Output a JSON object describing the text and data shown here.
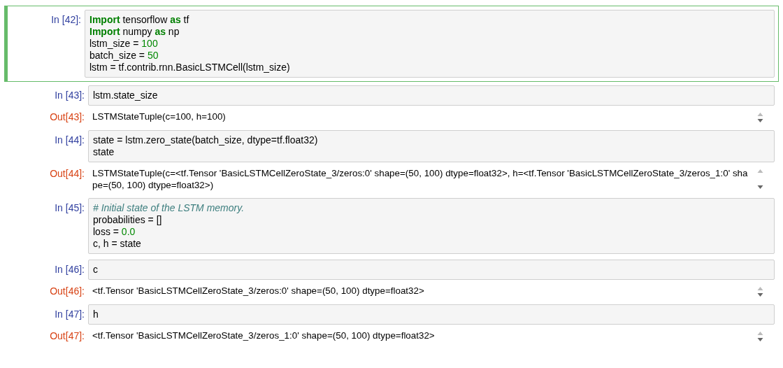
{
  "cells": [
    {
      "prompt": "In [42]:",
      "selected": true,
      "input": [
        [
          {
            "kind": "keyword",
            "text": "Import"
          },
          {
            "kind": "plain",
            "text": " tensorflow "
          },
          {
            "kind": "keyword",
            "text": "as"
          },
          {
            "kind": "plain",
            "text": " tf"
          }
        ],
        [
          {
            "kind": "keyword",
            "text": "Import"
          },
          {
            "kind": "plain",
            "text": " numpy "
          },
          {
            "kind": "keyword",
            "text": "as"
          },
          {
            "kind": "plain",
            "text": " np"
          }
        ],
        [
          {
            "kind": "plain",
            "text": "lstm_size = "
          },
          {
            "kind": "number",
            "text": "100"
          }
        ],
        [
          {
            "kind": "plain",
            "text": "batch_size = "
          },
          {
            "kind": "number",
            "text": "50"
          }
        ],
        [
          {
            "kind": "plain",
            "text": "lstm = tf.contrib.rnn.BasicLSTMCell(lstm_size)"
          }
        ]
      ]
    },
    {
      "prompt": "In [43]:",
      "selected": false,
      "input": [
        [
          {
            "kind": "plain",
            "text": "lstm.state_size"
          }
        ]
      ],
      "output": {
        "prompt": "Out[43]:",
        "lines": [
          "LSTMStateTuple(c=100, h=100)"
        ]
      }
    },
    {
      "prompt": "In [44]:",
      "selected": false,
      "input": [
        [
          {
            "kind": "plain",
            "text": "state = lstm.zero_state(batch_size, dtype=tf.float32)"
          }
        ],
        [
          {
            "kind": "plain",
            "text": "state"
          }
        ]
      ],
      "output": {
        "prompt": "Out[44]:",
        "lines": [
          "LSTMStateTuple(c=<tf.Tensor 'BasicLSTMCellZeroState_3/zeros:0' shape=(50, 100) dtype=float32>, h=<tf.Tensor 'BasicLSTMCellZeroState_3/zeros_1:0' sha",
          "pe=(50, 100) dtype=float32>)"
        ]
      }
    },
    {
      "prompt": "In [45]:",
      "selected": false,
      "input": [
        [
          {
            "kind": "comment",
            "text": "# Initial state of the LSTM memory."
          }
        ],
        [
          {
            "kind": "plain",
            "text": "probabilities = []"
          }
        ],
        [
          {
            "kind": "plain",
            "text": "loss = "
          },
          {
            "kind": "number",
            "text": "0.0"
          }
        ],
        [
          {
            "kind": "plain",
            "text": "c, h = state"
          }
        ]
      ]
    },
    {
      "prompt": "In [46]:",
      "selected": false,
      "input": [
        [
          {
            "kind": "plain",
            "text": "c"
          }
        ]
      ],
      "output": {
        "prompt": "Out[46]:",
        "lines": [
          "<tf.Tensor 'BasicLSTMCellZeroState_3/zeros:0' shape=(50, 100) dtype=float32>"
        ]
      }
    },
    {
      "prompt": "In [47]:",
      "selected": false,
      "input": [
        [
          {
            "kind": "plain",
            "text": "h"
          }
        ]
      ],
      "output": {
        "prompt": "Out[47]:",
        "lines": [
          "<tf.Tensor 'BasicLSTMCellZeroState_3/zeros_1:0' shape=(50, 100) dtype=float32>"
        ]
      }
    }
  ]
}
